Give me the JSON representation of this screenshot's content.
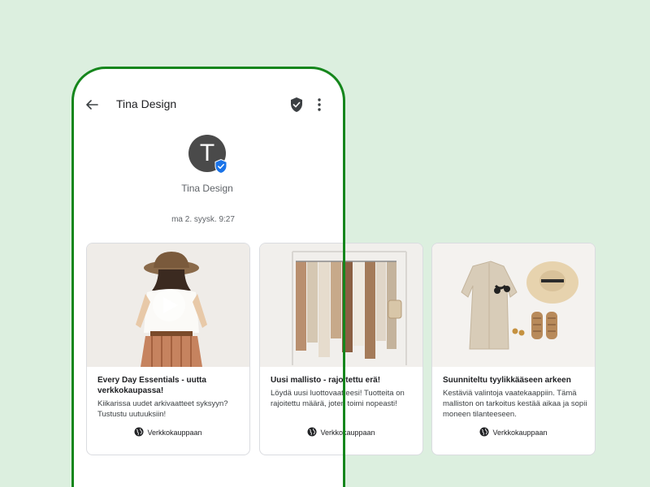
{
  "header": {
    "title": "Tina Design"
  },
  "profile": {
    "initial": "T",
    "name": "Tina Design"
  },
  "timestamp": "ma 2. syysk. 9:27",
  "cards": [
    {
      "title": "Every Day Essentials - uutta verkkokaupassa!",
      "description": "Kiikarissa uudet arkivaatteet syksyyn? Tustustu uutuuksiin!",
      "link": "Verkkokauppaan"
    },
    {
      "title": "Uusi mallisto - rajoitettu erä!",
      "description": "Löydä uusi luottovaatteesi! Tuotteita on rajoitettu määrä, joten toimi nopeasti!",
      "link": "Verkkokauppaan"
    },
    {
      "title": "Suunniteltu tyylikkääseen arkeen",
      "description": "Kestäviä valintoja vaatekaappiin. Tämä malliston on tarkoitus kestää aikaa ja sopii moneen tilanteeseen.",
      "link": "Verkkokauppaan"
    }
  ],
  "colors": {
    "background": "#dcefdf",
    "frame": "#15861c",
    "badge": "#1a73e8",
    "avatar": "#4a4a4a"
  }
}
